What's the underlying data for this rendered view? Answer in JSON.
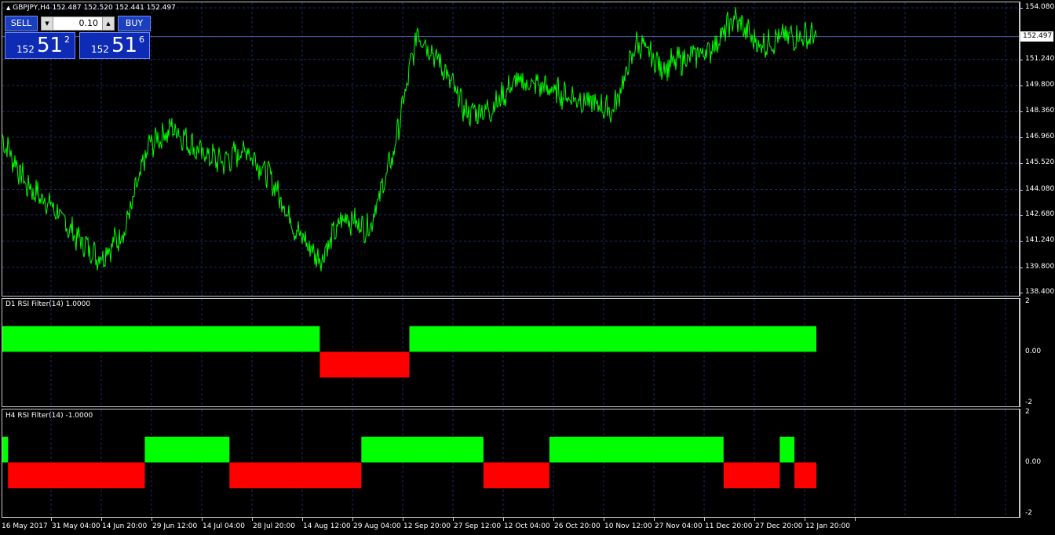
{
  "symbol_header": "GBPJPY,H4  152.487 152.520 152.441 152.497",
  "trade_panel": {
    "sell_label": "SELL",
    "buy_label": "BUY",
    "lot_value": "0.10",
    "sell_price_prefix": "152",
    "sell_price_big": "51",
    "sell_price_sup": "2",
    "buy_price_prefix": "152",
    "buy_price_big": "51",
    "buy_price_sup": "6"
  },
  "main_axis": {
    "labels": [
      "154.080",
      "152.497",
      "151.240",
      "149.800",
      "148.360",
      "146.960",
      "145.520",
      "144.080",
      "142.680",
      "141.240",
      "139.800",
      "138.400"
    ],
    "current_price": "152.497",
    "ymin": 138.4,
    "ymax": 154.08
  },
  "d1_pane": {
    "title": "D1 RSI Filter(14) 1.0000",
    "axis_labels": [
      "2",
      "0.00",
      "-2"
    ]
  },
  "h4_pane": {
    "title": "H4 RSI Filter(14) -1.0000",
    "axis_labels": [
      "2",
      "0.00",
      "-2"
    ]
  },
  "x_labels": [
    "16 May 2017",
    "31 May 04:00",
    "14 Jun 20:00",
    "29 Jun 12:00",
    "14 Jul 04:00",
    "28 Jul 20:00",
    "14 Aug 12:00",
    "29 Aug 04:00",
    "12 Sep 20:00",
    "27 Sep 12:00",
    "12 Oct 04:00",
    "26 Oct 20:00",
    "10 Nov 12:00",
    "27 Nov 04:00",
    "11 Dec 20:00",
    "27 Dec 20:00",
    "12 Jan 20:00"
  ],
  "colors": {
    "price_line": "#00ff00",
    "up_block": "#00ff00",
    "down_block": "#ff0000",
    "grid": "#1a2a6a"
  },
  "chart_data": [
    {
      "type": "line",
      "series": [
        {
          "name": "GBPJPY,H4",
          "x": [
            0,
            0.03,
            0.06,
            0.09,
            0.12,
            0.15,
            0.18,
            0.21,
            0.24,
            0.27,
            0.3,
            0.33,
            0.36,
            0.39,
            0.42,
            0.45,
            0.48,
            0.51,
            0.54,
            0.57,
            0.6,
            0.63,
            0.66,
            0.69,
            0.72,
            0.75,
            0.78,
            0.81,
            0.84,
            0.87,
            0.9,
            0.93,
            0.96,
            1.0
          ],
          "values": [
            146.9,
            144.3,
            143.2,
            141.5,
            140.3,
            141.8,
            146.5,
            147.5,
            146.2,
            145.6,
            146.3,
            144.7,
            141.9,
            140.2,
            142.6,
            141.9,
            146.0,
            152.8,
            150.9,
            148.3,
            148.5,
            150.0,
            149.8,
            149.3,
            148.9,
            148.4,
            152.2,
            150.8,
            151.3,
            151.8,
            153.5,
            152.0,
            152.5,
            152.5
          ]
        }
      ],
      "ylim": [
        138.4,
        154.08
      ]
    },
    {
      "type": "bar",
      "name": "D1 RSI Filter(14)",
      "segments": [
        {
          "from": 0.0,
          "to": 0.39,
          "value": 1
        },
        {
          "from": 0.39,
          "to": 0.5,
          "value": -1
        },
        {
          "from": 0.5,
          "to": 1.0,
          "value": 1
        }
      ],
      "ylim": [
        -2,
        2
      ]
    },
    {
      "type": "bar",
      "name": "H4 RSI Filter(14)",
      "segments": [
        {
          "from": 0.0,
          "to": 0.007,
          "value": 1
        },
        {
          "from": 0.007,
          "to": 0.175,
          "value": -1
        },
        {
          "from": 0.175,
          "to": 0.279,
          "value": 1
        },
        {
          "from": 0.279,
          "to": 0.441,
          "value": -1
        },
        {
          "from": 0.441,
          "to": 0.591,
          "value": 1
        },
        {
          "from": 0.591,
          "to": 0.672,
          "value": -1
        },
        {
          "from": 0.672,
          "to": 0.886,
          "value": 1
        },
        {
          "from": 0.886,
          "to": 0.955,
          "value": -1
        },
        {
          "from": 0.955,
          "to": 0.973,
          "value": 1
        },
        {
          "from": 0.973,
          "to": 1.0,
          "value": -1
        }
      ],
      "ylim": [
        -2,
        2
      ]
    }
  ]
}
